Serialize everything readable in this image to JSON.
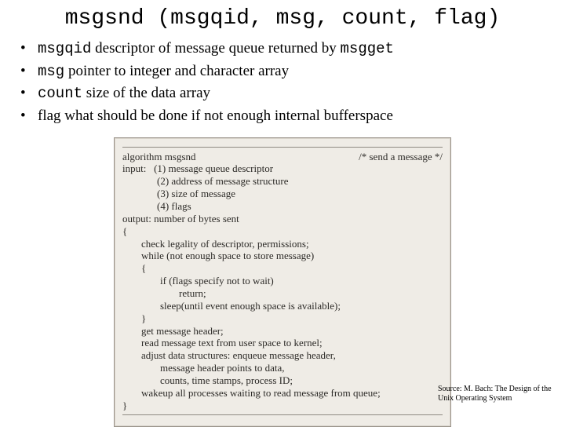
{
  "title": "msgsnd (msgqid, msg, count, flag)",
  "bullets": [
    {
      "code": "msgqid",
      "pre": " descriptor of message queue returned by ",
      "code2": "msgget",
      "post": ""
    },
    {
      "code": "msg",
      "pre": "  pointer to integer and character array",
      "code2": "",
      "post": ""
    },
    {
      "code": "count",
      "pre": " size of the data array",
      "code2": "",
      "post": ""
    },
    {
      "code": "",
      "pre": "flag what should be done if not enough internal bufferspace",
      "code2": "",
      "post": ""
    }
  ],
  "figure": {
    "alg_label": "algorithm msgsnd",
    "alg_comment": "/* send a message */",
    "input_label": "input:",
    "inputs": [
      "(1) message queue descriptor",
      "(2) address of message structure",
      "(3) size of message",
      "(4) flags"
    ],
    "output": "output: number of bytes sent",
    "open1": "{",
    "line1": "check legality of descriptor, permissions;",
    "line2": "while (not enough space to store message)",
    "open2": "{",
    "line3": "if (flags specify not to wait)",
    "line4": "return;",
    "line5": "sleep(until event enough space is available);",
    "close2": "}",
    "line6": "get message header;",
    "line7": "read message text from user space to kernel;",
    "line8": "adjust data structures: enqueue message header,",
    "line9": "message header points to data,",
    "line10": "counts, time stamps, process ID;",
    "line11": "wakeup all processes waiting to read message from queue;",
    "close1": "}"
  },
  "citation": "Source: M. Bach: The Design of the Unix Operating System"
}
